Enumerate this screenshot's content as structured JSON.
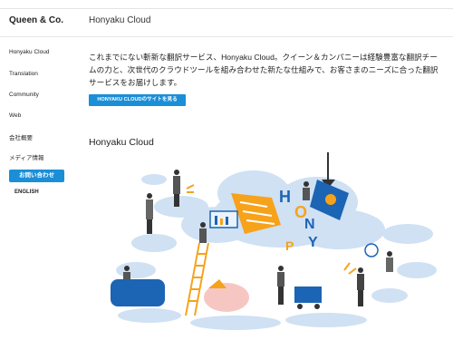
{
  "header": {
    "brand": "Queen & Co.",
    "title": "Honyaku Cloud"
  },
  "sidebar": {
    "items": [
      {
        "label": "Honyaku Cloud"
      },
      {
        "label": "Translation"
      },
      {
        "label": "Community"
      },
      {
        "label": "Web"
      },
      {
        "label": "会社概要"
      },
      {
        "label": "メディア情報"
      }
    ],
    "contact_label": "お問い合わせ",
    "language_label": "ENGLISH"
  },
  "main": {
    "intro": "これまでにない斬新な翻訳サービス、Honyaku Cloud。クイーン＆カンパニーは経験豊富な翻訳チームの力と、次世代のクラウドツールを組み合わせた新たな仕組みで、お客さまのニーズに合った翻訳サービスをお届けします。",
    "cta_label": "HONYAKU CLOUDのサイトを見る",
    "section_title": "Honyaku Cloud",
    "illustration_letters": [
      "H",
      "O",
      "N",
      "Y",
      "P"
    ]
  },
  "colors": {
    "accent": "#1a8fd8",
    "cloud": "#cfe1f3",
    "orange": "#f7a21b",
    "navy": "#2c4a7a"
  }
}
